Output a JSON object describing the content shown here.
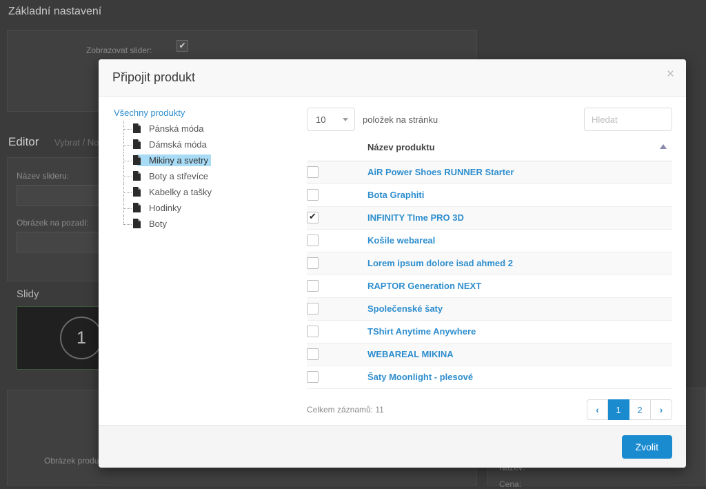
{
  "background": {
    "page_title": "Základní nastavení",
    "show_slider_label": "Zobrazovat slider:",
    "show_slider_checked_glyph": "✔",
    "editor_title": "Editor",
    "editor_link": "Vybrat / No",
    "slider_name_label": "Název slideru:",
    "background_image_label": "Obrázek na pozadí:",
    "slides_label": "Slidy",
    "slide_number": "1",
    "product_image_label": "Obrázek produ",
    "right_name_label": "Nazev:",
    "right_price_label": "Cena:"
  },
  "modal": {
    "title": "Připojit produkt",
    "close_icon_label": "×",
    "tree": {
      "root_label": "Všechny produkty",
      "items": [
        {
          "label": "Pánská móda",
          "selected": false
        },
        {
          "label": "Dámská móda",
          "selected": false
        },
        {
          "label": "Mikiny a svetry",
          "selected": true
        },
        {
          "label": "Boty a střevíce",
          "selected": false
        },
        {
          "label": "Kabelky a tašky",
          "selected": false
        },
        {
          "label": "Hodinky",
          "selected": false
        },
        {
          "label": "Boty",
          "selected": false
        }
      ]
    },
    "toolbar": {
      "per_page_value": "10",
      "per_page_label": "položek na stránku",
      "search_placeholder": "Hledat",
      "search_value": ""
    },
    "table": {
      "header_checkbox": "",
      "header_name": "Název produktu",
      "sort_direction": "asc",
      "rows": [
        {
          "name": "AiR Power Shoes RUNNER Starter",
          "checked": false
        },
        {
          "name": "Bota Graphiti",
          "checked": false
        },
        {
          "name": "INFINITY TIme PRO 3D",
          "checked": true
        },
        {
          "name": "Košile webareal",
          "checked": false
        },
        {
          "name": "Lorem ipsum dolore isad ahmed 2",
          "checked": false
        },
        {
          "name": "RAPTOR Generation NEXT",
          "checked": false
        },
        {
          "name": "Společenské šaty",
          "checked": false
        },
        {
          "name": "TShirt Anytime Anywhere",
          "checked": false
        },
        {
          "name": "WEBAREAL MIKINA",
          "checked": false
        },
        {
          "name": "Šaty Moonlight - plesové",
          "checked": false
        }
      ]
    },
    "footer": {
      "total_records": "Celkem záznamů: 11",
      "pager": {
        "prev_icon": "‹",
        "pages": [
          "1",
          "2"
        ],
        "active_page": "1",
        "next_icon": "›"
      },
      "confirm_label": "Zvolit"
    }
  },
  "colors": {
    "accent_blue": "#1b8bd0",
    "link_blue": "#2e8ece",
    "tree_selected": "#a8dbf5",
    "backdrop": "#3b3b3b"
  }
}
